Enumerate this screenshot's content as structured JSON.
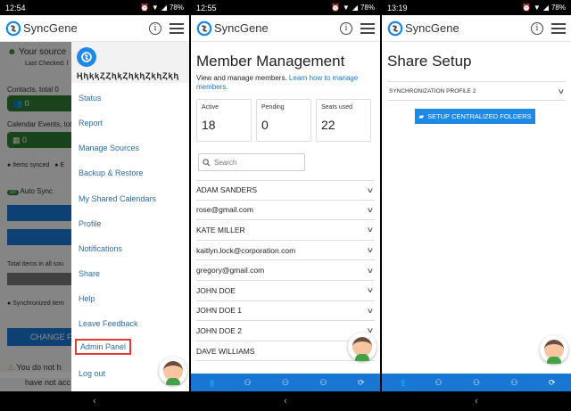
{
  "screens": [
    {
      "time": "12:54",
      "battery": "78%",
      "app_name": "SyncGene",
      "underlying": {
        "source_text": "Your source",
        "last_checked": "Last Checked: l",
        "contacts": "Contacts, total 0",
        "contacts_value": "0",
        "calendar": "Calendar Events, tota",
        "calendar_value": "0",
        "items_synced": "Items synced",
        "items_e": "E",
        "auto_sync": "Auto Sync",
        "total_items": "Total items in all sou",
        "synchronized": "Synchronized item",
        "change_btn": "CHANGE FO",
        "warning_line1": "You do not h",
        "warning_line2": "have not acc"
      },
      "drawer": {
        "user": "ⱧⱨⱪⱪⱫⱫⱨⱪⱫⱨⱪⱨⱫⱪⱨⱫⱪⱨ",
        "items": [
          "Status",
          "Report",
          "Manage Sources",
          "Backup & Restore",
          "My Shared Calendars",
          "Profile",
          "Notifications",
          "Share",
          "Help",
          "Leave Feedback",
          "Admin Panel",
          "Log out"
        ]
      }
    },
    {
      "time": "12:55",
      "battery": "78%",
      "app_name": "SyncGene",
      "title": "Member Management",
      "subtitle": "View and manage members.",
      "learn_link": "Learn how to manage members.",
      "stats": [
        {
          "label": "Active",
          "value": "18"
        },
        {
          "label": "Pending",
          "value": "0"
        },
        {
          "label": "Seats used",
          "value": "22"
        }
      ],
      "search_placeholder": "Search",
      "members": [
        "ADAM SANDERS",
        "rose@gmail.com",
        "KATE MILLER",
        "kaitlyn.lock@corporation.com",
        "gregory@gmail.com",
        "JOHN DOE",
        "JOHN DOE 1",
        "JOHN DOE 2",
        "DAVE WILLIAMS"
      ]
    },
    {
      "time": "13:19",
      "battery": "78%",
      "app_name": "SyncGene",
      "title": "Share Setup",
      "profile": "SYNCHRONIZATION PROFILE 2",
      "setup_button": "SETUP CENTRALIZED FOLDERS"
    }
  ],
  "nav_back": "‹",
  "colors": {
    "accent": "#1976d2",
    "green": "#2e7d32",
    "highlight": "#e53935"
  }
}
